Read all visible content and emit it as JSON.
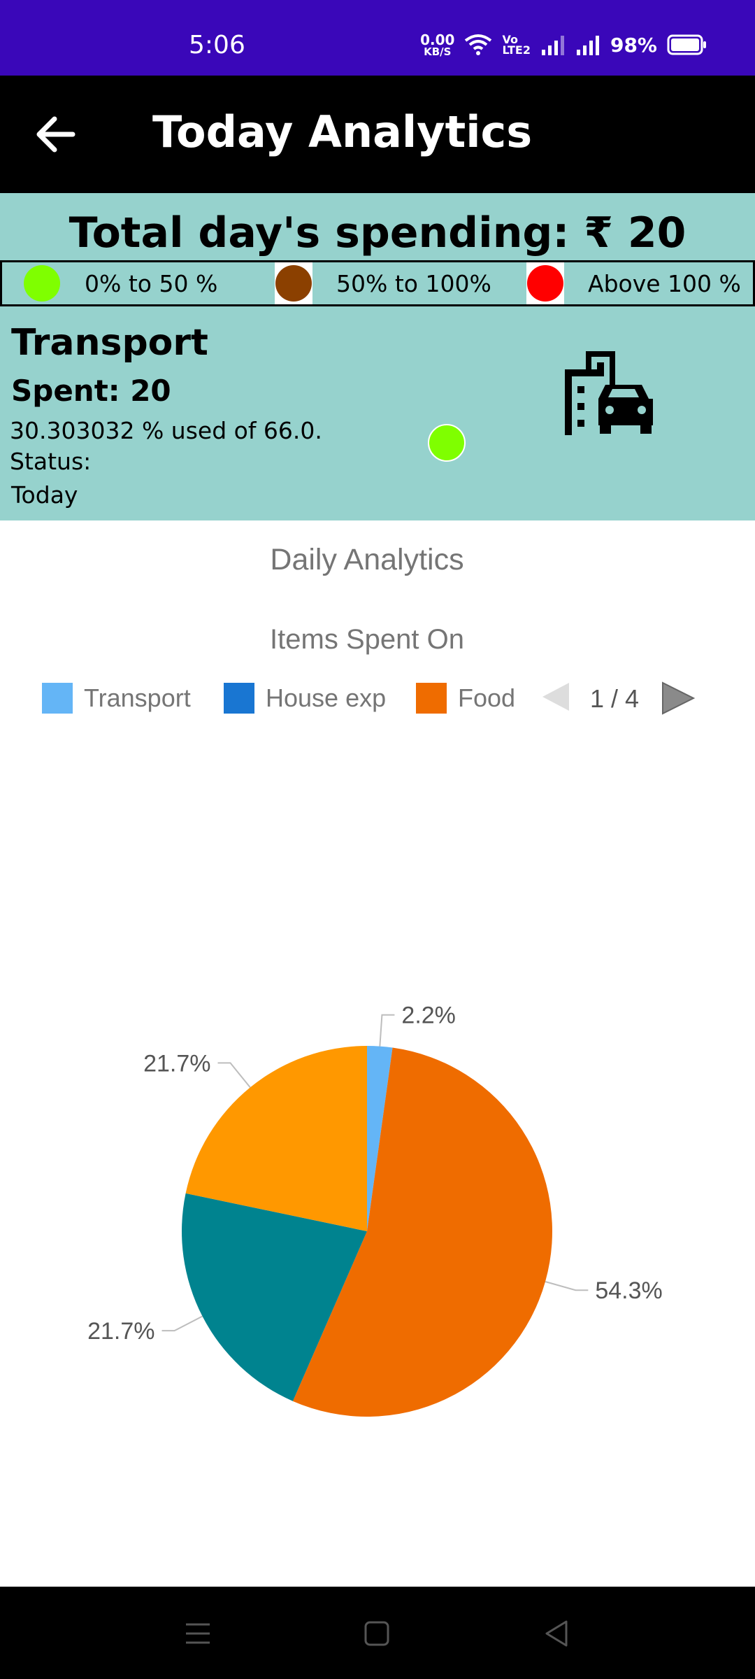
{
  "status_bar": {
    "time": "5:06",
    "net_speed_value": "0.00",
    "net_speed_unit": "KB/S",
    "volte_top": "Vo",
    "volte_bottom": "LTE2",
    "battery": "98%"
  },
  "app_bar": {
    "title": "Today Analytics",
    "back_icon": "arrow-left-icon"
  },
  "summary": {
    "total_label": "Total day's spending: ₹ 20",
    "legend": [
      {
        "label": "0% to 50 %",
        "color": "#7fff00"
      },
      {
        "label": "50% to 100%",
        "color": "#8b4000"
      },
      {
        "label": "Above 100 %",
        "color": "#ff0000"
      }
    ],
    "category": "Transport",
    "spent": "Spent: 20",
    "percent_text": "30.303032 % used of 66.0.",
    "status_label": "Status:",
    "status_color": "#7fff00",
    "period": "Today",
    "category_icon": "city-car-icon"
  },
  "chart": {
    "title": "Daily Analytics",
    "subtitle": "Items Spent On",
    "legend": [
      {
        "label": "Transport",
        "color": "#64b5f6"
      },
      {
        "label": "House exp",
        "color": "#1976d2"
      },
      {
        "label": "Food",
        "color": "#ef6c00"
      }
    ],
    "pager": "1 / 4"
  },
  "chart_data": {
    "type": "pie",
    "title": "Items Spent On",
    "slices": [
      {
        "value": 2.2,
        "label": "2.2%",
        "color": "#64b5f6"
      },
      {
        "value": 54.3,
        "label": "54.3%",
        "color": "#ef6c00"
      },
      {
        "value": 21.7,
        "label": "21.7%",
        "color": "#00838f"
      },
      {
        "value": 21.7,
        "label": "21.7%",
        "color": "#ff9800"
      }
    ]
  },
  "nav_bar": {
    "icons": [
      "menu-icon",
      "home-square-icon",
      "back-triangle-icon"
    ]
  }
}
